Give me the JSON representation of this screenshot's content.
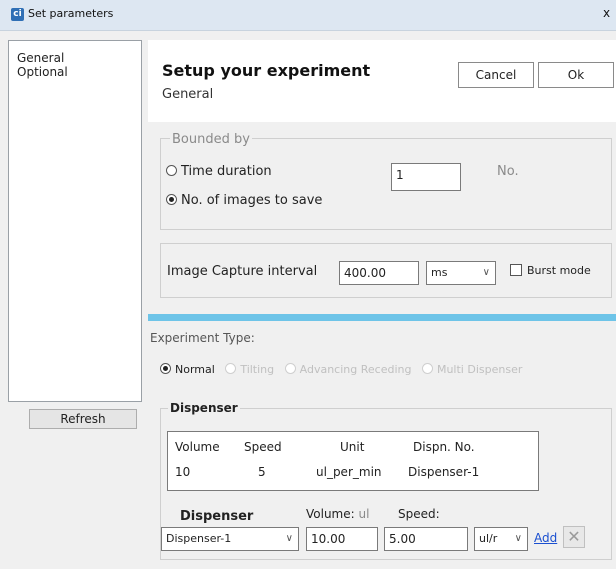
{
  "window": {
    "title": "Set parameters",
    "app_icon": "ci",
    "close": "x"
  },
  "nav": {
    "items": [
      {
        "label": "General"
      },
      {
        "label": "Optional"
      }
    ],
    "refresh_label": "Refresh"
  },
  "header": {
    "title": "Setup your experiment",
    "subtitle": "General",
    "cancel_label": "Cancel",
    "ok_label": "Ok"
  },
  "bounded": {
    "legend": "Bounded by",
    "time_duration_label": "Time duration",
    "images_label": "No. of images to save",
    "selected": "No. of images to save",
    "count_value": "1",
    "unit_label": "No."
  },
  "capture": {
    "label": "Image Capture interval",
    "value": "400.00",
    "unit": "ms",
    "burst_label": "Burst mode",
    "burst_checked": false
  },
  "experiment": {
    "label": "Experiment Type:",
    "options": [
      {
        "label": "Normal",
        "selected": true,
        "enabled": true
      },
      {
        "label": "Tilting",
        "selected": false,
        "enabled": false
      },
      {
        "label": "Advancing Receding",
        "selected": false,
        "enabled": false
      },
      {
        "label": "Multi Dispenser",
        "selected": false,
        "enabled": false
      }
    ]
  },
  "dispenser": {
    "title": "Dispenser",
    "table": {
      "headers": [
        "Volume",
        "Speed",
        "Unit",
        "Dispn. No."
      ],
      "rows": [
        [
          "10",
          "5",
          "ul_per_min",
          "Dispenser-1"
        ]
      ]
    },
    "dispenser_label": "Dispenser",
    "volume_label": "Volume:",
    "volume_unit": "ul",
    "speed_label": "Speed:",
    "selected_dispenser": "Dispenser-1",
    "volume_value": "10.00",
    "speed_value": "5.00",
    "speed_unit": "ul/r",
    "add_label": "Add",
    "delete_glyph": "✕"
  }
}
